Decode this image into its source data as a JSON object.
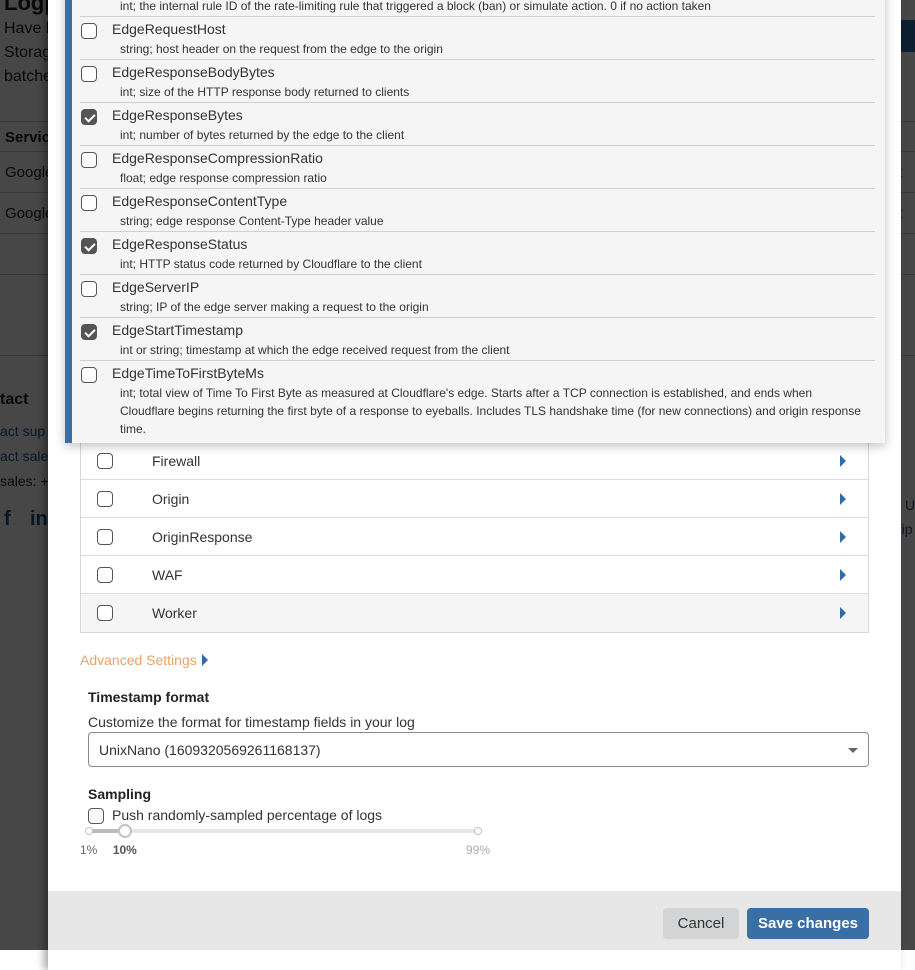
{
  "background": {
    "title": "Logpush",
    "intro_lines": [
      "Have l",
      "Storag",
      "batche"
    ],
    "table_header": "Servic",
    "table_rows": [
      "Google",
      "Google"
    ],
    "row_action": "it",
    "contact_heading": "tact",
    "contact_links": [
      "act sup",
      "act sale"
    ],
    "sales_phone": "sales: +",
    "social_icons": [
      "facebook-icon",
      "linkedin-icon"
    ],
    "right_fragments": [
      "U",
      "rip"
    ]
  },
  "field_popup": {
    "truncated_top_desc": "int; the internal rule ID of the rate-limiting rule that triggered a block (ban) or simulate action. 0 if no action taken",
    "fields": [
      {
        "name": "EdgeRequestHost",
        "desc": "string; host header on the request from the edge to the origin",
        "checked": false
      },
      {
        "name": "EdgeResponseBodyBytes",
        "desc": "int; size of the HTTP response body returned to clients",
        "checked": false
      },
      {
        "name": "EdgeResponseBytes",
        "desc": "int; number of bytes returned by the edge to the client",
        "checked": true
      },
      {
        "name": "EdgeResponseCompressionRatio",
        "desc": "float; edge response compression ratio",
        "checked": false
      },
      {
        "name": "EdgeResponseContentType",
        "desc": "string; edge response Content-Type header value",
        "checked": false
      },
      {
        "name": "EdgeResponseStatus",
        "desc": "int; HTTP status code returned by Cloudflare to the client",
        "checked": true
      },
      {
        "name": "EdgeServerIP",
        "desc": "string; IP of the edge server making a request to the origin",
        "checked": false
      },
      {
        "name": "EdgeStartTimestamp",
        "desc": "int or string; timestamp at which the edge received request from the client",
        "checked": true
      },
      {
        "name": "EdgeTimeToFirstByteMs",
        "desc": "int; total view of Time To First Byte as measured at Cloudflare's edge. Starts after a TCP connection is established, and ends when Cloudflare begins returning the first byte of a response to eyeballs. Includes TLS handshake time (for new connections) and origin response time.",
        "checked": false
      }
    ]
  },
  "categories": [
    {
      "label": "Firewall",
      "checked": false
    },
    {
      "label": "Origin",
      "checked": false
    },
    {
      "label": "OriginResponse",
      "checked": false
    },
    {
      "label": "WAF",
      "checked": false
    },
    {
      "label": "Worker",
      "checked": false
    }
  ],
  "advanced": {
    "toggle_label": "Advanced Settings",
    "timestamp": {
      "title": "Timestamp format",
      "desc": "Customize the format for timestamp fields in your log",
      "selected": "UnixNano (1609320569261168137)"
    },
    "sampling": {
      "title": "Sampling",
      "checkbox_label": "Push randomly-sampled percentage of logs",
      "checked": false,
      "min_label": "1%",
      "value_label": "10%",
      "max_label": "99%",
      "min": 1,
      "max": 99,
      "value": 10
    }
  },
  "footer": {
    "cancel_label": "Cancel",
    "save_label": "Save changes"
  },
  "colors": {
    "accent_blue": "#3a6fa5",
    "advanced_link": "#e8a366"
  }
}
